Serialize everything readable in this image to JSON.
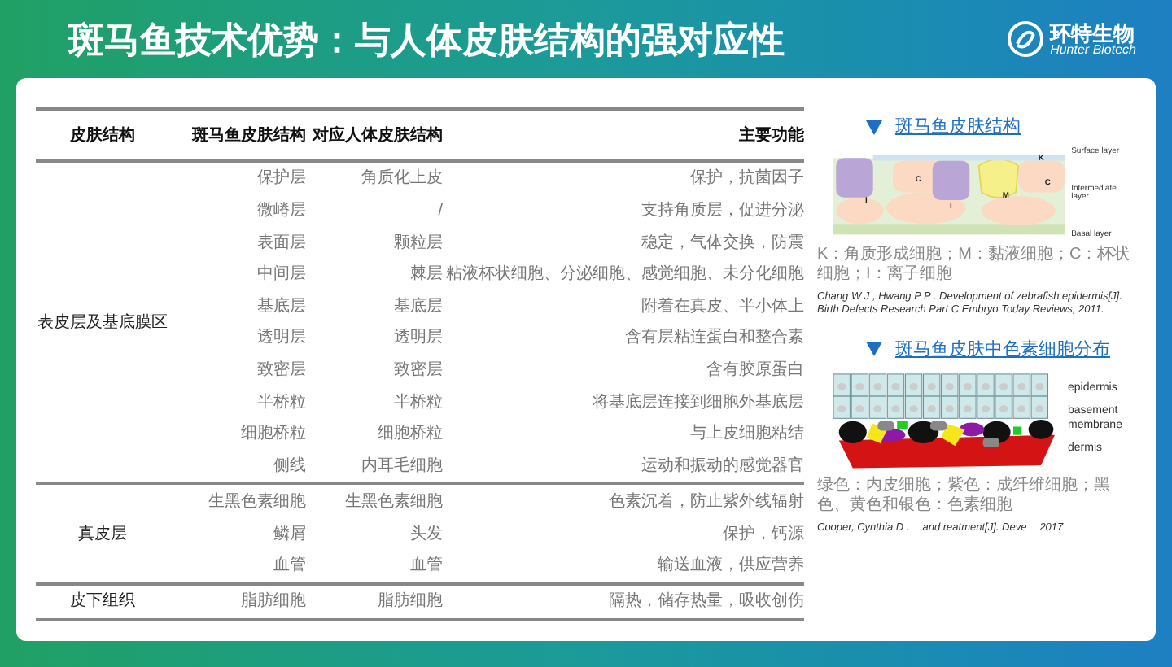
{
  "header": {
    "title": "斑马鱼技术优势：与人体皮肤结构的强对应性",
    "logo": {
      "name": "环特生物",
      "subtitle": "Hunter Biotech"
    }
  },
  "table": {
    "columns": [
      "皮肤结构",
      "斑马鱼皮肤结构",
      "对应人体皮肤结构",
      "主要功能"
    ],
    "groups": [
      {
        "region": "表皮层及基底膜区",
        "rows": [
          {
            "zebrafish": "保护层",
            "human": "角质化上皮",
            "function": "保护，抗菌因子"
          },
          {
            "zebrafish": "微嵴层",
            "human": "/",
            "function": "支持角质层，促进分泌"
          },
          {
            "zebrafish": "表面层",
            "human": "颗粒层",
            "function": "稳定，气体交换，防震"
          },
          {
            "zebrafish": "中间层",
            "human": "棘层",
            "function": "粘液杯状细胞、分泌细胞、感觉细胞、未分化细胞"
          },
          {
            "zebrafish": "基底层",
            "human": "基底层",
            "function": "附着在真皮、半小体上"
          },
          {
            "zebrafish": "透明层",
            "human": "透明层",
            "function": "含有层粘连蛋白和整合素"
          },
          {
            "zebrafish": "致密层",
            "human": "致密层",
            "function": "含有胶原蛋白"
          },
          {
            "zebrafish": "半桥粒",
            "human": "半桥粒",
            "function": "将基底层连接到细胞外基底层"
          },
          {
            "zebrafish": "细胞桥粒",
            "human": "细胞桥粒",
            "function": "与上皮细胞粘结"
          },
          {
            "zebrafish": "侧线",
            "human": "内耳毛细胞",
            "function": "运动和振动的感觉器官"
          }
        ]
      },
      {
        "region": "真皮层",
        "rows": [
          {
            "zebrafish": "生黑色素细胞",
            "human": "生黑色素细胞",
            "function": "色素沉着，防止紫外线辐射"
          },
          {
            "zebrafish": "鳞屑",
            "human": "头发",
            "function": "保护，钙源"
          },
          {
            "zebrafish": "血管",
            "human": "血管",
            "function": "输送血液，供应营养"
          }
        ]
      },
      {
        "region": "皮下组织",
        "rows": [
          {
            "zebrafish": "脂肪细胞",
            "human": "脂肪细胞",
            "function": "隔热，储存热量，吸收创伤"
          }
        ]
      }
    ]
  },
  "figures": [
    {
      "kind": "epidermis",
      "title": "斑马鱼皮肤结构",
      "cell_labels": [
        "I",
        "C",
        "I",
        "M",
        "C",
        "K"
      ],
      "layer_labels": [
        "Surface layer",
        "Intermediate layer",
        "Basal layer"
      ],
      "caption": "K：角质形成细胞；M：黏液细胞；C：杯状细胞；I：离子细胞",
      "citation": [
        "Chang W J , Hwang P P . Development of zebrafish epidermis[J]. Birth Defects Research Part C Embryo Today Reviews, 2011."
      ]
    },
    {
      "kind": "pigment",
      "title": "斑马鱼皮肤中色素细胞分布",
      "layer_labels": [
        "epidermis",
        "basement membrane",
        "dermis"
      ],
      "caption": "绿色：内皮细胞；紫色：成纤维细胞；黑色、黄色和银色：色素细胞",
      "citation": [
        "Cooper, Cynthia D .",
        "and reatment[J]. Deve",
        "2017"
      ]
    }
  ]
}
